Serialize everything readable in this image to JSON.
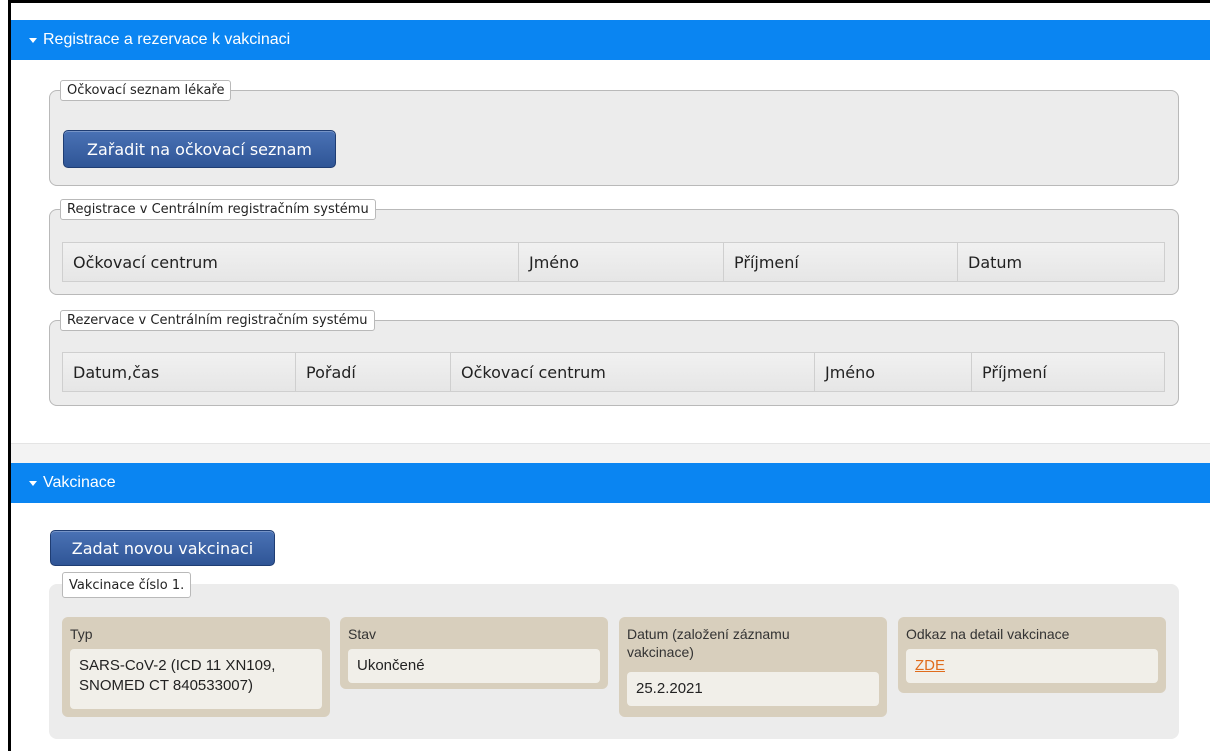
{
  "registration_section": {
    "title": "Registrace a rezervace k vakcinaci",
    "doctor_list": {
      "legend": "Očkovací seznam lékaře",
      "add_button": "Zařadit na očkovací seznam"
    },
    "registration": {
      "legend": "Registrace v Centrálním registračním systému",
      "columns": [
        "Očkovací centrum",
        "Jméno",
        "Příjmení",
        "Datum"
      ]
    },
    "reservation": {
      "legend": "Rezervace v Centrálním registračním systému",
      "columns": [
        "Datum,čas",
        "Pořadí",
        "Očkovací centrum",
        "Jméno",
        "Příjmení"
      ]
    }
  },
  "vaccination_section": {
    "title": "Vakcinace",
    "new_button": "Zadat novou vakcinaci",
    "entry": {
      "legend": "Vakcinace číslo 1.",
      "type_label": "Typ",
      "type_value": "SARS-CoV-2 (ICD 11 XN109, SNOMED CT 840533007)",
      "status_label": "Stav",
      "status_value": "Ukončené",
      "date_label": "Datum (založení záznamu vakcinace)",
      "date_value": "25.2.2021",
      "link_label": "Odkaz na detail vakcinace",
      "link_value": "ZDE"
    }
  },
  "colors": {
    "header_blue": "#0a85f2",
    "button_blue": "#2f5596",
    "card_bg": "#d8cfbd",
    "link_orange": "#e06c1c"
  }
}
